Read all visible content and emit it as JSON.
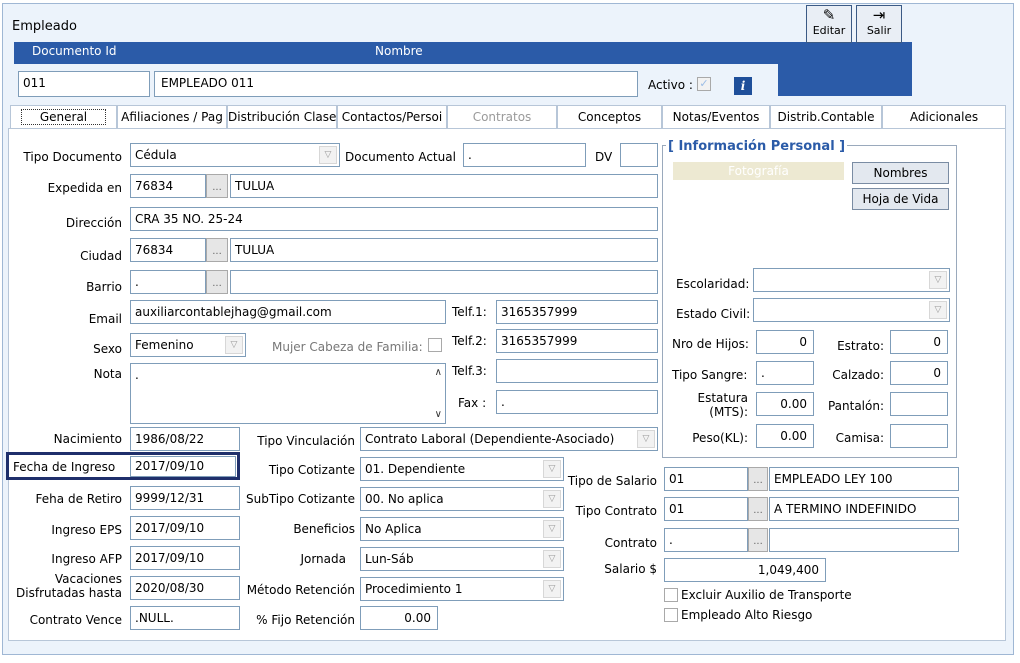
{
  "window": {
    "title": "Empleado"
  },
  "header": {
    "doc_id_label": "Documento Id",
    "nombre_label": "Nombre",
    "doc_id_value": "011",
    "nombre_value": "EMPLEADO 011",
    "activo_label": "Activo :",
    "info_icon": "i",
    "editar_label": "Editar",
    "salir_label": "Salir"
  },
  "tabs": [
    {
      "label": "General"
    },
    {
      "label": "Afiliaciones / Pag"
    },
    {
      "label": "Distribución Clase"
    },
    {
      "label": "Contactos/Persoi"
    },
    {
      "label": "Contratos"
    },
    {
      "label": "Conceptos"
    },
    {
      "label": "Notas/Eventos"
    },
    {
      "label": "Distrib.Contable"
    },
    {
      "label": "Adicionales"
    }
  ],
  "form": {
    "tipo_documento_label": "Tipo Documento",
    "tipo_documento_value": "Cédula",
    "documento_actual_label": "Documento Actual",
    "documento_actual_value": ".",
    "dv_label": "DV",
    "dv_value": "",
    "expedida_label": "Expedida en",
    "expedida_code": "76834",
    "expedida_city": "TULUA",
    "direccion_label": "Dirección",
    "direccion_value": "CRA 35 NO. 25-24",
    "ciudad_label": "Ciudad",
    "ciudad_code": "76834",
    "ciudad_city": "TULUA",
    "barrio_label": "Barrio",
    "barrio_code": ".",
    "barrio_name": "",
    "email_label": "Email",
    "email_value": "auxiliarcontablejhag@gmail.com",
    "telf1_label": "Telf.1:",
    "telf1_value": "3165357999",
    "sexo_label": "Sexo",
    "sexo_value": "Femenino",
    "mujer_cabeza_label": "Mujer Cabeza de Familia:",
    "telf2_label": "Telf.2:",
    "telf2_value": "3165357999",
    "nota_label": "Nota",
    "nota_value": ".",
    "telf3_label": "Telf.3:",
    "telf3_value": "",
    "fax_label": "Fax :",
    "fax_value": ".",
    "nacimiento_label": "Nacimiento",
    "nacimiento_value": "1986/08/22",
    "tipo_vinculacion_label": "Tipo Vinculación",
    "tipo_vinculacion_value": "Contrato Laboral (Dependiente-Asociado)",
    "fecha_ingreso_label": "Fecha de Ingreso",
    "fecha_ingreso_value": "2017/09/10",
    "tipo_cotizante_label": "Tipo Cotizante",
    "tipo_cotizante_value": "01. Dependiente",
    "tipo_salario_label": "Tipo de Salario",
    "tipo_salario_code": "01",
    "tipo_salario_name": "EMPLEADO LEY 100",
    "fecha_retiro_label": "Feha de Retiro",
    "fecha_retiro_value": "9999/12/31",
    "subtipo_cotizante_label": "SubTipo Cotizante",
    "subtipo_cotizante_value": "00. No aplica",
    "tipo_contrato_label": "Tipo Contrato",
    "tipo_contrato_code": "01",
    "tipo_contrato_name": "A TERMINO INDEFINIDO",
    "ingreso_eps_label": "Ingreso EPS",
    "ingreso_eps_value": "2017/09/10",
    "beneficios_label": "Beneficios",
    "beneficios_value": "No Aplica",
    "contrato_label": "Contrato",
    "contrato_code": ".",
    "contrato_name": "",
    "ingreso_afp_label": "Ingreso AFP",
    "ingreso_afp_value": "2017/09/10",
    "jornada_label": "Jornada",
    "jornada_value": "Lun-Sáb",
    "salario_label": "Salario $",
    "salario_value": "1,049,400",
    "vacaciones_label_1": "Vacaciones",
    "vacaciones_label_2": "Disfrutadas hasta",
    "vacaciones_value": "2020/08/30",
    "metodo_retencion_label": "Método Retención",
    "metodo_retencion_value": "Procedimiento 1",
    "excluir_auxilio_label": "Excluir Auxilio de Transporte",
    "contrato_vence_label": "Contrato Vence",
    "contrato_vence_value": ".NULL.",
    "fijo_retencion_label": "% Fijo Retención",
    "fijo_retencion_value": "0.00",
    "alto_riesgo_label": "Empleado Alto Riesgo"
  },
  "info_personal": {
    "title": "[ Información Personal ]",
    "fotografia_label": "Fotografía",
    "nombres_button": "Nombres",
    "hoja_vida_button": "Hoja de Vida",
    "escolaridad_label": "Escolaridad:",
    "escolaridad_value": "",
    "estado_civil_label": "Estado Civil:",
    "estado_civil_value": "",
    "nro_hijos_label": "Nro de Hijos:",
    "nro_hijos_value": "0",
    "estrato_label": "Estrato:",
    "estrato_value": "0",
    "tipo_sangre_label": "Tipo Sangre:",
    "tipo_sangre_value": ".",
    "calzado_label": "Calzado:",
    "calzado_value": "0",
    "estatura_label_1": "Estatura",
    "estatura_label_2": "(MTS):",
    "estatura_value": "0.00",
    "pantalon_label": "Pantalón:",
    "pantalon_value": "",
    "peso_label": "Peso(KL):",
    "peso_value": "0.00",
    "camisa_label": "Camisa:",
    "camisa_value": ""
  }
}
